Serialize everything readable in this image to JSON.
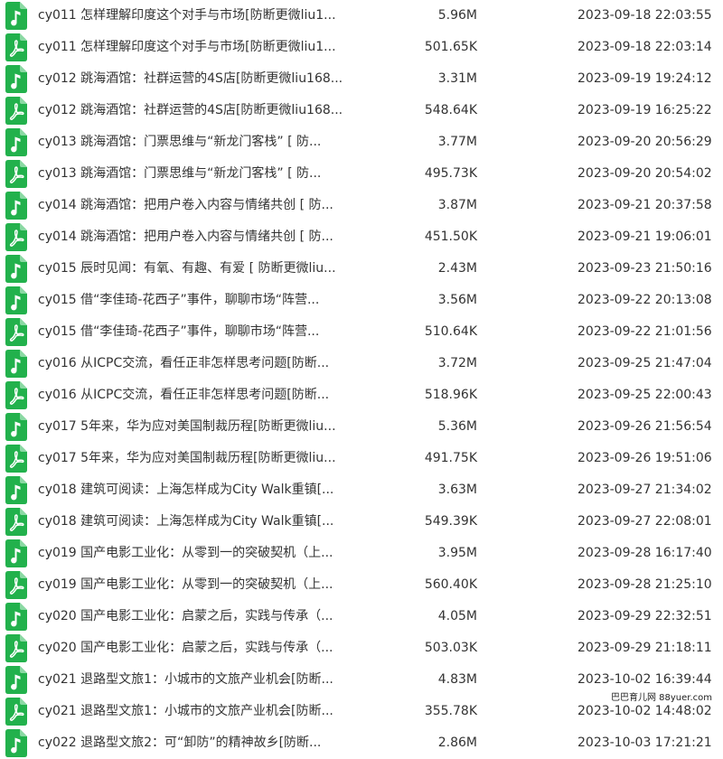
{
  "colors": {
    "icon_green": "#22b14c",
    "text": "#333333"
  },
  "icons": {
    "audio": "music-file-icon",
    "pdf": "pdf-file-icon"
  },
  "files": [
    {
      "name": "cy011 怎样理解印度这个对手与市场[防断更微liu1...",
      "size": "5.96M",
      "date": "2023-09-18 22:03:55",
      "type": "audio"
    },
    {
      "name": "cy011 怎样理解印度这个对手与市场[防断更微liu1...",
      "size": "501.65K",
      "date": "2023-09-18 22:03:14",
      "type": "pdf"
    },
    {
      "name": "cy012 跳海酒馆：社群运营的4S店[防断更微liu168...",
      "size": "3.31M",
      "date": "2023-09-19 19:24:12",
      "type": "audio"
    },
    {
      "name": "cy012 跳海酒馆：社群运营的4S店[防断更微liu168...",
      "size": "548.64K",
      "date": "2023-09-19 16:25:22",
      "type": "pdf"
    },
    {
      "name": "cy013 跳海酒馆：门票思维与“新龙门客栈” [ 防...",
      "size": "3.77M",
      "date": "2023-09-20 20:56:29",
      "type": "audio"
    },
    {
      "name": "cy013 跳海酒馆：门票思维与“新龙门客栈” [ 防...",
      "size": "495.73K",
      "date": "2023-09-20 20:54:02",
      "type": "pdf"
    },
    {
      "name": "cy014 跳海酒馆：把用户卷入内容与情绪共创 [ 防...",
      "size": "3.87M",
      "date": "2023-09-21 20:37:58",
      "type": "audio"
    },
    {
      "name": "cy014 跳海酒馆：把用户卷入内容与情绪共创 [ 防...",
      "size": "451.50K",
      "date": "2023-09-21 19:06:01",
      "type": "pdf"
    },
    {
      "name": "cy015 辰时见闻：有氧、有趣、有爱 [ 防断更微liu...",
      "size": "2.43M",
      "date": "2023-09-23 21:50:16",
      "type": "audio"
    },
    {
      "name": "cy015 借“李佳琦-花西子”事件，聊聊市场“阵营...",
      "size": "3.56M",
      "date": "2023-09-22 20:13:08",
      "type": "audio"
    },
    {
      "name": "cy015 借“李佳琦-花西子”事件，聊聊市场“阵营...",
      "size": "510.64K",
      "date": "2023-09-22 21:01:56",
      "type": "pdf"
    },
    {
      "name": "cy016 从ICPC交流，看任正非怎样思考问题[防断...",
      "size": "3.72M",
      "date": "2023-09-25 21:47:04",
      "type": "audio"
    },
    {
      "name": "cy016 从ICPC交流，看任正非怎样思考问题[防断...",
      "size": "518.96K",
      "date": "2023-09-25 22:00:43",
      "type": "pdf"
    },
    {
      "name": "cy017 5年来，华为应对美国制裁历程[防断更微liu...",
      "size": "5.36M",
      "date": "2023-09-26 21:56:54",
      "type": "audio"
    },
    {
      "name": "cy017 5年来，华为应对美国制裁历程[防断更微liu...",
      "size": "491.75K",
      "date": "2023-09-26 19:51:06",
      "type": "pdf"
    },
    {
      "name": "cy018 建筑可阅读：上海怎样成为City Walk重镇[...",
      "size": "3.63M",
      "date": "2023-09-27 21:34:02",
      "type": "audio"
    },
    {
      "name": "cy018 建筑可阅读：上海怎样成为City Walk重镇[...",
      "size": "549.39K",
      "date": "2023-09-27 22:08:01",
      "type": "pdf"
    },
    {
      "name": "cy019 国产电影工业化：从零到一的突破契机（上...",
      "size": "3.95M",
      "date": "2023-09-28 16:17:40",
      "type": "audio"
    },
    {
      "name": "cy019 国产电影工业化：从零到一的突破契机（上...",
      "size": "560.40K",
      "date": "2023-09-28 21:25:10",
      "type": "pdf"
    },
    {
      "name": "cy020 国产电影工业化：启蒙之后，实践与传承（...",
      "size": "4.05M",
      "date": "2023-09-29 22:32:51",
      "type": "audio"
    },
    {
      "name": "cy020 国产电影工业化：启蒙之后，实践与传承（...",
      "size": "503.03K",
      "date": "2023-09-29 21:18:11",
      "type": "pdf"
    },
    {
      "name": "cy021 退路型文旅1：小城市的文旅产业机会[防断...",
      "size": "4.83M",
      "date": "2023-10-02 16:39:44",
      "type": "audio"
    },
    {
      "name": "cy021 退路型文旅1：小城市的文旅产业机会[防断...",
      "size": "355.78K",
      "date": "2023-10-02 14:48:02",
      "type": "pdf"
    },
    {
      "name": "cy022 退路型文旅2：可“卸防”的精神故乡[防断...",
      "size": "2.86M",
      "date": "2023-10-03 17:21:21",
      "type": "audio"
    }
  ],
  "watermark": "巴巴育儿网 88yuer.com"
}
